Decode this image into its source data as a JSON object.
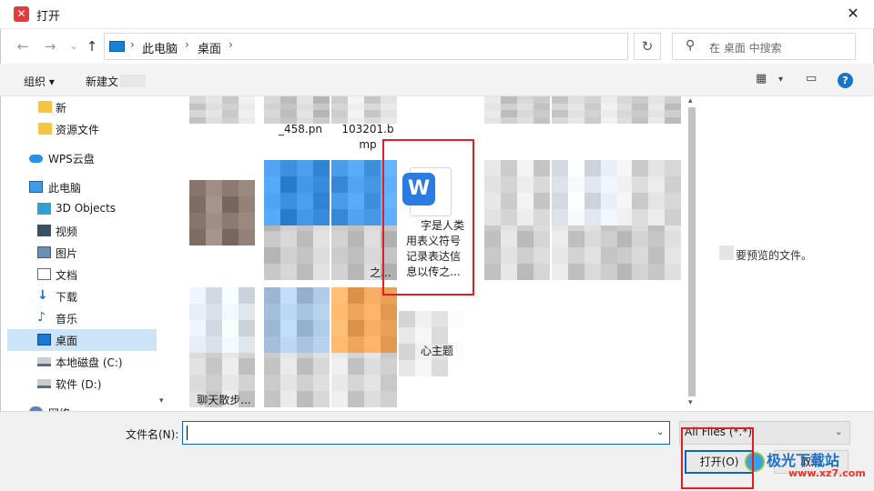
{
  "window": {
    "title": "打开",
    "close_glyph": "✕",
    "app_icon_glyph": "✕"
  },
  "address_bar": {
    "breadcrumbs": [
      "此电脑",
      "桌面"
    ],
    "separator": "›",
    "back_glyph": "←",
    "forward_glyph": "→",
    "dropdown_glyph": "⌄",
    "up_glyph": "↑",
    "addr_dropdown_glyph": "⌄",
    "refresh_glyph": "↻",
    "search_placeholder": "在 桌面 中搜索",
    "search_glyph": "⚲"
  },
  "toolbar": {
    "organize_label": "组织 ▾",
    "new_folder_label": "新建文",
    "view_glyph": "▦",
    "view_dd_glyph": "▾",
    "pane_glyph": "▭",
    "help_glyph": "?"
  },
  "sidebar": {
    "items": [
      {
        "label": "新",
        "icon": "folder-icon"
      },
      {
        "label": "资源文件",
        "icon": "folder-icon"
      },
      {
        "label": "WPS云盘",
        "icon": "cloud-icon"
      },
      {
        "label": "此电脑",
        "icon": "computer-icon"
      },
      {
        "label": "3D Objects",
        "icon": "cube-icon"
      },
      {
        "label": "视频",
        "icon": "video-icon"
      },
      {
        "label": "图片",
        "icon": "picture-icon"
      },
      {
        "label": "文档",
        "icon": "document-icon"
      },
      {
        "label": "下载",
        "icon": "download-icon",
        "glyph": "↓"
      },
      {
        "label": "音乐",
        "icon": "music-icon",
        "glyph": "♪"
      },
      {
        "label": "桌面",
        "icon": "desktop-icon",
        "selected": true
      },
      {
        "label": "本地磁盘 (C:)",
        "icon": "drive-icon"
      },
      {
        "label": "软件 (D:)",
        "icon": "drive-icon"
      },
      {
        "label": "网络",
        "icon": "network-icon"
      }
    ]
  },
  "content": {
    "visible_labels": [
      "_458.pn",
      "103201.b",
      "mp",
      "之...",
      "心主题",
      "聊天散步..."
    ],
    "highlighted_file": {
      "name_lines": [
        "字是人类",
        "用表义符号",
        "记录表达信",
        "息以传之..."
      ],
      "icon": "wps-writer-icon",
      "icon_glyph": "W"
    }
  },
  "scroll_glyphs": {
    "up": "▴",
    "down": "▾"
  },
  "preview": {
    "message": "要预览的文件。"
  },
  "footer": {
    "filename_label": "文件名(N):",
    "filename_value": "",
    "filename_dd_glyph": "⌄",
    "filetype_value": "All Files (*.*)",
    "filetype_dd_glyph": "⌄",
    "open_button": "打开(O)",
    "cancel_button": "取消"
  },
  "watermark": {
    "text": "极光下载站",
    "url": "www.xz7.com"
  },
  "colors": {
    "accent": "#0a64c8",
    "highlight": "#e02020",
    "selection": "#cce4f7",
    "toolbar_bg": "#f3f3f3"
  }
}
